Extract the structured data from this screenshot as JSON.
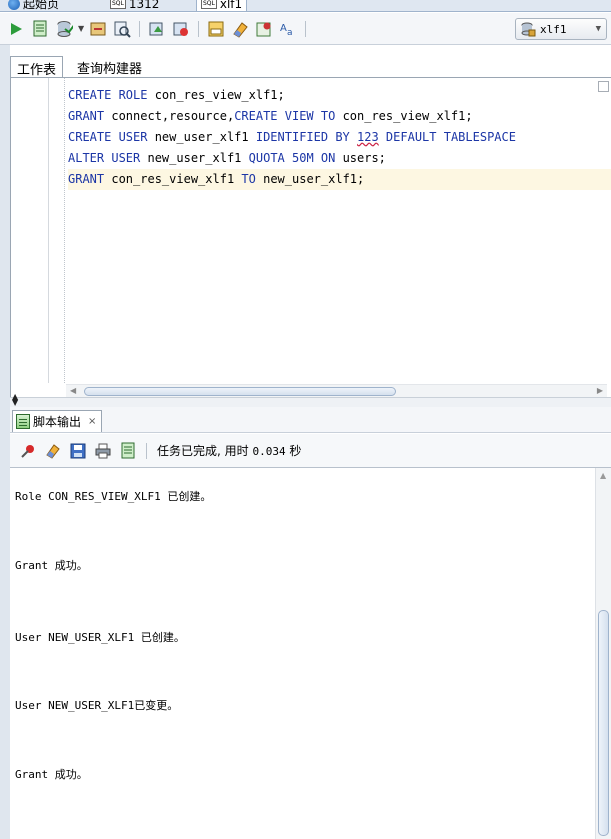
{
  "doc_tabs": [
    {
      "label": "起始页"
    },
    {
      "label": "1312"
    },
    {
      "label": "xlf1"
    }
  ],
  "sql_badge": "SQL",
  "toolbar": {
    "connection_label": "xlf1"
  },
  "editor": {
    "tab_worksheet": "工作表",
    "tab_query_builder": "查询构建器",
    "lines": [
      {
        "kw1": "CREATE ROLE ",
        "rest": "con_res_view_xlf1;"
      },
      {
        "kw1": "GRANT ",
        "rest": "connect,resource,",
        "kw2": "CREATE VIEW TO ",
        "tail": "con_res_view_xlf1;"
      },
      {
        "kw1": "CREATE USER ",
        "rest": "new_user_xlf1 ",
        "kw2": "IDENTIFIED BY ",
        "num": "123",
        "tail": " DEFAULT TABLESPACE"
      },
      {
        "kw1": "ALTER USER ",
        "rest": "new_user_xlf1 ",
        "kw2": "QUOTA 50M ON ",
        "tail": "users;"
      },
      {
        "kw1": "GRANT ",
        "rest": "con_res_view_xlf1 ",
        "kw2": "TO ",
        "tail": "new_user_xlf1;"
      }
    ]
  },
  "output_panel": {
    "tab_label": "脚本输出",
    "close_label": "×",
    "status_prefix": "任务已完成, 用时 ",
    "status_time": "0.034",
    "status_suffix": " 秒",
    "lines": [
      "Role CON_RES_VIEW_XLF1 已创建。",
      "Grant 成功。",
      "User NEW_USER_XLF1 已创建。",
      "User NEW_USER_XLF1已变更。",
      "Grant 成功。"
    ]
  }
}
